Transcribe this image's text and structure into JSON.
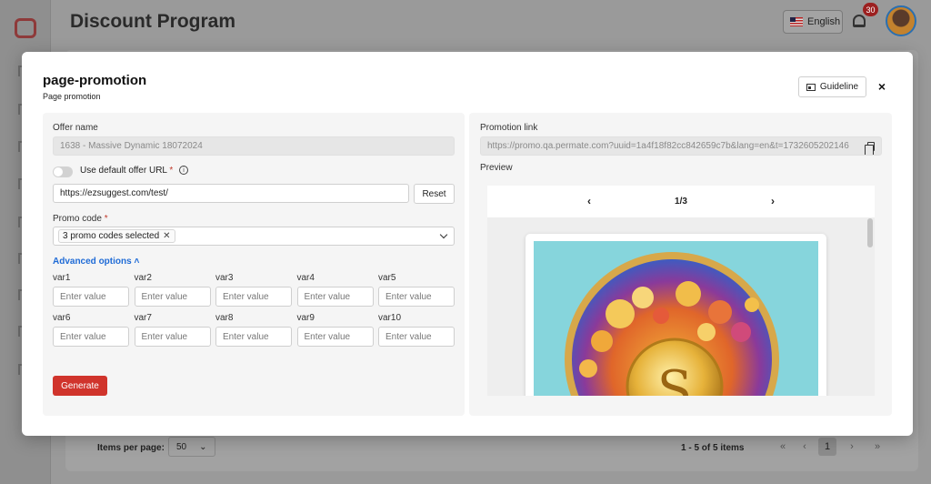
{
  "app": {
    "title": "Discount Program",
    "language": "English",
    "notification_count": "30"
  },
  "pagination": {
    "items_per_page_label": "Items per page:",
    "items_per_page_value": "50",
    "range_text": "1 - 5 of 5 items",
    "first": "«",
    "prev": "‹",
    "current_page": "1",
    "next": "›",
    "last": "»"
  },
  "modal": {
    "title": "page-promotion",
    "subtitle": "Page promotion",
    "guideline_label": "Guideline",
    "close_label": "×"
  },
  "form": {
    "offer_name_label": "Offer name",
    "offer_name_value": "1638 - Massive Dynamic 18072024",
    "use_default_url_label": "Use default offer URL",
    "use_default_url_required": "*",
    "use_default_url_on": false,
    "offer_url_value": "https://ezsuggest.com/test/",
    "reset_label": "Reset",
    "promo_code_label": "Promo code",
    "promo_code_required": "*",
    "promo_code_chip": "3 promo codes selected",
    "advanced_options_label": "Advanced options",
    "advanced_options_caret": "˄",
    "var_placeholder": "Enter value",
    "vars": [
      "var1",
      "var2",
      "var3",
      "var4",
      "var5",
      "var6",
      "var7",
      "var8",
      "var9",
      "var10"
    ],
    "generate_label": "Generate"
  },
  "promotion": {
    "link_label": "Promotion link",
    "link_value": "https://promo.qa.permate.com?uuid=1a4f18f82cc842659c7b&lang=en&t=1732605202146",
    "preview_label": "Preview",
    "page_indicator": "1/3",
    "prev_arrow": "‹",
    "next_arrow": "›"
  },
  "colors": {
    "primary_button": "#d0342c",
    "link_accent": "#1f6bd6",
    "notification_badge": "#9c2020"
  }
}
